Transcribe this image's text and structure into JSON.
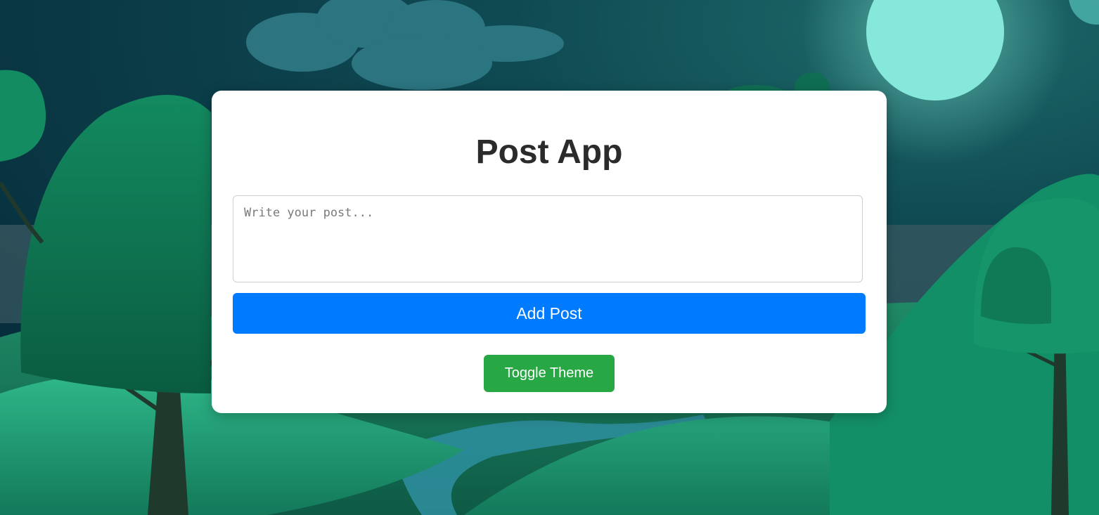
{
  "app": {
    "title": "Post App"
  },
  "composer": {
    "placeholder": "Write your post...",
    "value": ""
  },
  "actions": {
    "add_post_label": "Add Post",
    "toggle_theme_label": "Toggle Theme"
  },
  "colors": {
    "add_post_button": "#007bff",
    "toggle_theme_button": "#28a745",
    "card_background": "#ffffff",
    "title_text": "#2b2b2b"
  }
}
